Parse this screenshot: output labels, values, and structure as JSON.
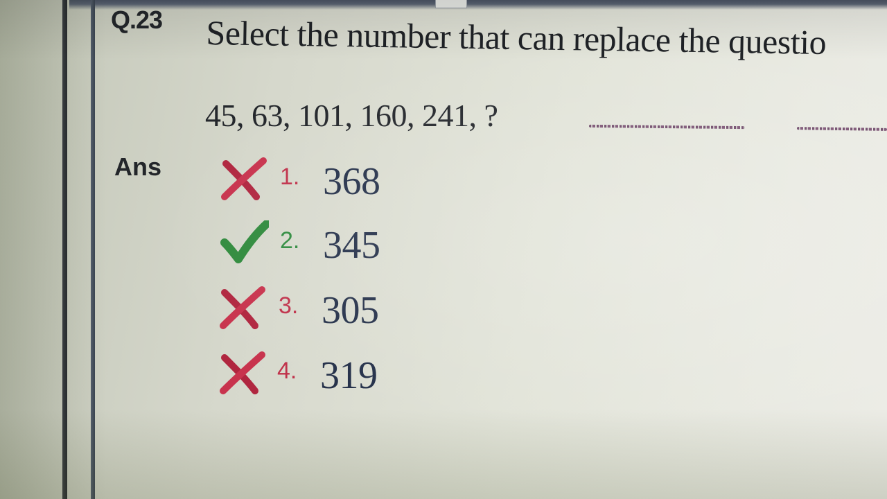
{
  "question": {
    "number": "Q.23",
    "text": "Select the number that can replace the questio",
    "sequence": "45, 63, 101, 160, 241, ?"
  },
  "answer": {
    "label": "Ans",
    "options": [
      {
        "number": "1.",
        "value": "368",
        "status": "wrong",
        "icon": "cross-icon"
      },
      {
        "number": "2.",
        "value": "345",
        "status": "correct",
        "icon": "check-icon"
      },
      {
        "number": "3.",
        "value": "305",
        "status": "wrong",
        "icon": "cross-icon"
      },
      {
        "number": "4.",
        "value": "319",
        "status": "wrong",
        "icon": "cross-icon"
      }
    ]
  },
  "colors": {
    "wrong": "#c0314a",
    "correct": "#2e8b3e"
  }
}
